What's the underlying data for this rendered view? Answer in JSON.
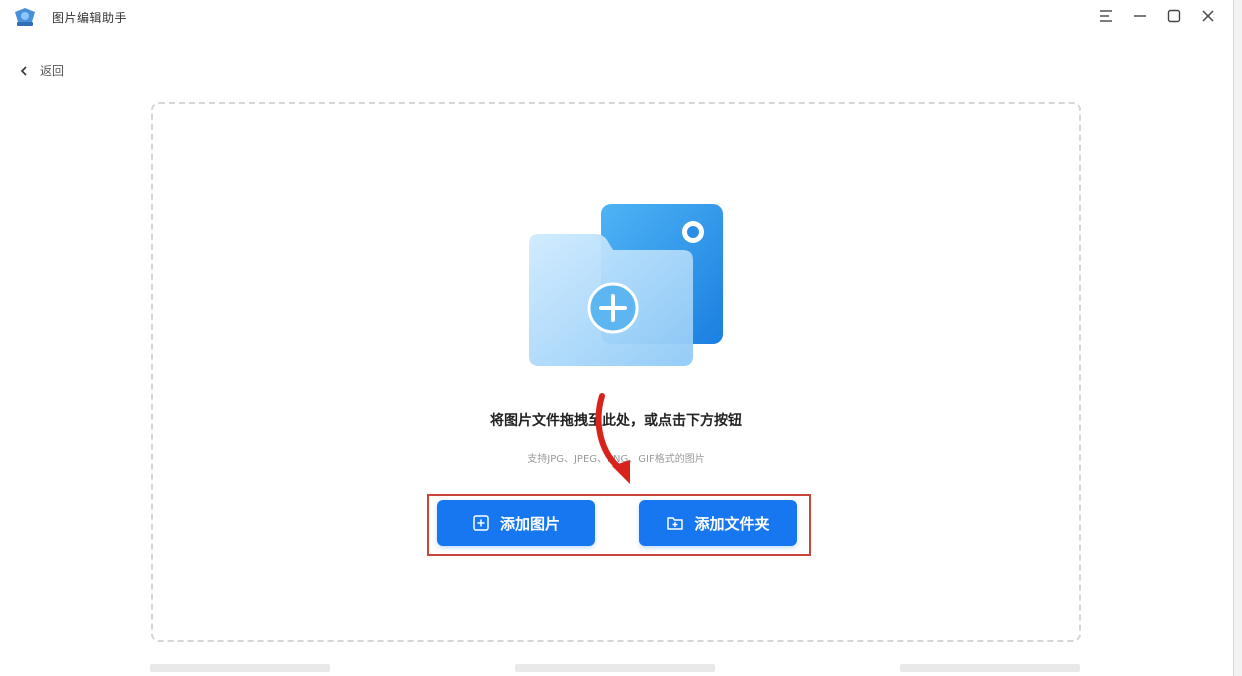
{
  "app": {
    "title": "图片编辑助手",
    "logo_icon": "app-logo-icon"
  },
  "window_controls": {
    "menu_icon": "menu-icon",
    "minimize_icon": "minimize-icon",
    "maximize_icon": "maximize-icon",
    "close_icon": "close-icon"
  },
  "nav": {
    "back_label": "返回",
    "back_icon": "chevron-left-icon"
  },
  "dropzone": {
    "hint": "将图片文件拖拽至此处，或点击下方按钮",
    "formats": "支持JPG、JPEG、PNG、GIF格式的图片",
    "illustration_icon": "add-image-illustration-icon"
  },
  "actions": {
    "add_image_label": "添加图片",
    "add_image_icon": "plus-square-icon",
    "add_folder_label": "添加文件夹",
    "add_folder_icon": "folder-plus-icon"
  },
  "colors": {
    "primary": "#1677f0",
    "highlight_border": "#c8463b",
    "annotation_arrow": "#d8231c"
  }
}
